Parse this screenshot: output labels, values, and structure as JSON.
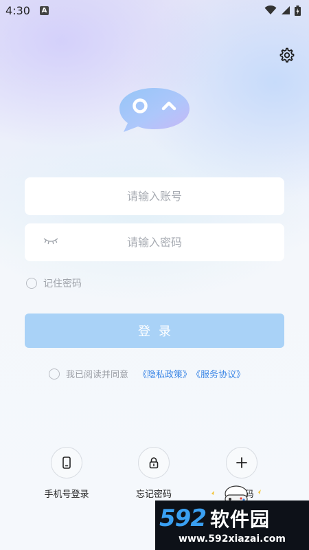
{
  "status_bar": {
    "time": "4:30",
    "notification_icon": "a-letter-icon",
    "icons": [
      "wifi-icon",
      "signal-icon",
      "battery-icon"
    ]
  },
  "header": {
    "settings_icon": "gear-icon"
  },
  "logo": {
    "icon": "chat-bubble-face-icon"
  },
  "form": {
    "account_placeholder": "请输入账号",
    "password_placeholder": "请输入密码",
    "password_visibility_icon": "closed-eye-icon",
    "remember_label": "记住密码",
    "login_label": "登录"
  },
  "agreement": {
    "text": "我已阅读并同意",
    "privacy_link": "《隐私政策》",
    "service_link": "《服务协议》"
  },
  "bottom_actions": [
    {
      "label": "手机号登录",
      "icon": "phone-icon"
    },
    {
      "label": "忘记密码",
      "icon": "lock-icon"
    },
    {
      "label": "码",
      "icon": "plus-icon"
    }
  ],
  "watermark": {
    "number": "592",
    "name": "软件园",
    "url": "www.592xiazai.com"
  },
  "colors": {
    "accent": "#3a86e6",
    "login_button": "#a9d2f7",
    "placeholder": "#a9adb4",
    "background": "#f5f8fc"
  }
}
